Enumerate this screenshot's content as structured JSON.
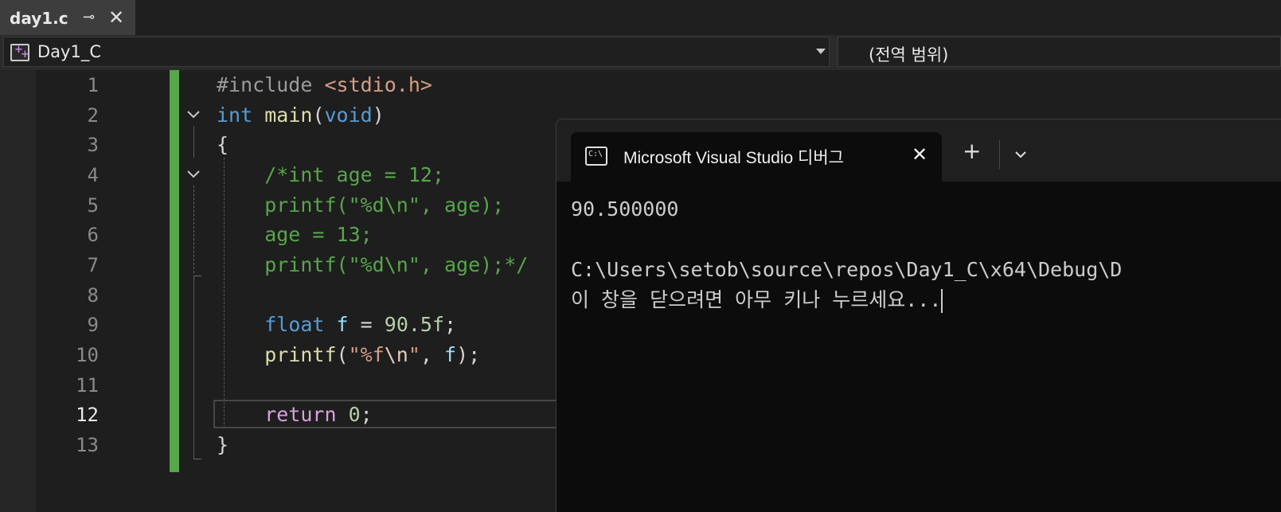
{
  "tab": {
    "title": "day1.c",
    "pin_glyph": "⊸",
    "close_glyph": "✕"
  },
  "navbar": {
    "project": "Day1_C",
    "scope": "(전역 범위)"
  },
  "editor": {
    "line_numbers": [
      "1",
      "2",
      "3",
      "4",
      "5",
      "6",
      "7",
      "8",
      "9",
      "10",
      "11",
      "12",
      "13"
    ],
    "current_line": "12"
  },
  "code": {
    "l1": {
      "a": "#include ",
      "b": "<stdio.h>"
    },
    "l2": {
      "a": "int",
      "b": " ",
      "c": "main",
      "d": "(",
      "e": "void",
      "f": ")"
    },
    "l3": {
      "a": "{"
    },
    "l4": {
      "a": "    /*int age = 12;"
    },
    "l5": {
      "a": "    printf(\"%d\\n\", age);"
    },
    "l6": {
      "a": "    age = 13;"
    },
    "l7": {
      "a": "    printf(\"%d\\n\", age);*/"
    },
    "l9": {
      "a": "    ",
      "b": "float",
      "c": " ",
      "d": "f",
      "e": " = ",
      "f": "90.5f",
      "g": ";"
    },
    "l10": {
      "a": "    ",
      "b": "printf",
      "c": "(",
      "d": "\"%f",
      "e": "\\n",
      "f": "\"",
      "g": ", ",
      "h": "f",
      "i": ");"
    },
    "l12": {
      "a": "    ",
      "b": "return",
      "c": " ",
      "d": "0",
      "e": ";"
    },
    "l13": {
      "a": "}"
    }
  },
  "console": {
    "icon_text": "C:\\",
    "title": "Microsoft Visual Studio 디버그",
    "close_glyph": "✕",
    "new_tab_glyph": "+",
    "output_line1": "90.500000",
    "output_line3": "C:\\Users\\setob\\source\\repos\\Day1_C\\x64\\Debug\\D",
    "output_line4": "이 창을 닫으려면 아무 키나 누르세요..."
  },
  "colors": {
    "change_bar": "#57a64a",
    "keyword": "#569cd6",
    "comment": "#57a64a",
    "string": "#d69d85",
    "function": "#dcdcaa",
    "control": "#d8a0df"
  }
}
